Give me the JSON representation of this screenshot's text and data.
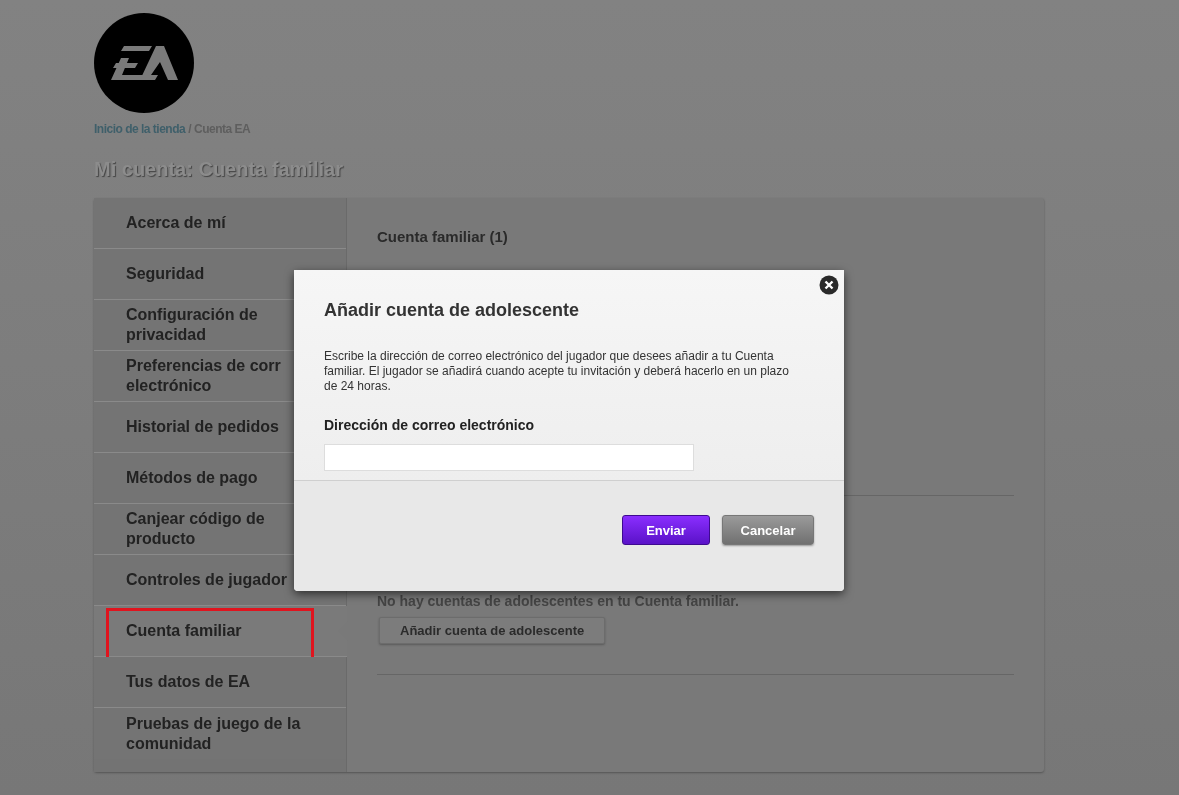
{
  "breadcrumb": {
    "link": "Inicio de la tienda",
    "separator": "/",
    "current": "Cuenta EA"
  },
  "page_title": "Mi cuenta: Cuenta familiar",
  "sidebar": {
    "items": [
      {
        "lines": [
          "Acerca de mí"
        ],
        "selected": false
      },
      {
        "lines": [
          "Seguridad"
        ],
        "selected": false
      },
      {
        "lines": [
          "Configuración de",
          "privacidad"
        ],
        "selected": false
      },
      {
        "lines": [
          "Preferencias de corr",
          "electrónico"
        ],
        "selected": false
      },
      {
        "lines": [
          "Historial de pedidos"
        ],
        "selected": false
      },
      {
        "lines": [
          "Métodos de pago"
        ],
        "selected": false
      },
      {
        "lines": [
          "Canjear código de",
          "producto"
        ],
        "selected": false
      },
      {
        "lines": [
          "Controles de jugador"
        ],
        "selected": false
      },
      {
        "lines": [
          "Cuenta familiar"
        ],
        "selected": true
      },
      {
        "lines": [
          "Tus datos de EA"
        ],
        "selected": false
      },
      {
        "lines": [
          "Pruebas de juego de la",
          "comunidad"
        ],
        "selected": false
      }
    ]
  },
  "content": {
    "heading": "Cuenta familiar (1)",
    "empty_message": "No hay cuentas de adolescentes en tu Cuenta familiar.",
    "add_button": "Añadir cuenta de adolescente"
  },
  "dialog": {
    "title": "Añadir cuenta de adolescente",
    "description": "Escribe la dirección de correo electrónico del jugador que desees añadir a tu Cuenta familiar. El jugador se añadirá cuando acepte tu invitación y deberá hacerlo en un plazo de 24 horas.",
    "field_label": "Dirección de correo electrónico",
    "buttons": [
      {
        "label": "Enviar",
        "kind": "primary"
      },
      {
        "label": "Cancelar",
        "kind": "secondary"
      }
    ]
  }
}
